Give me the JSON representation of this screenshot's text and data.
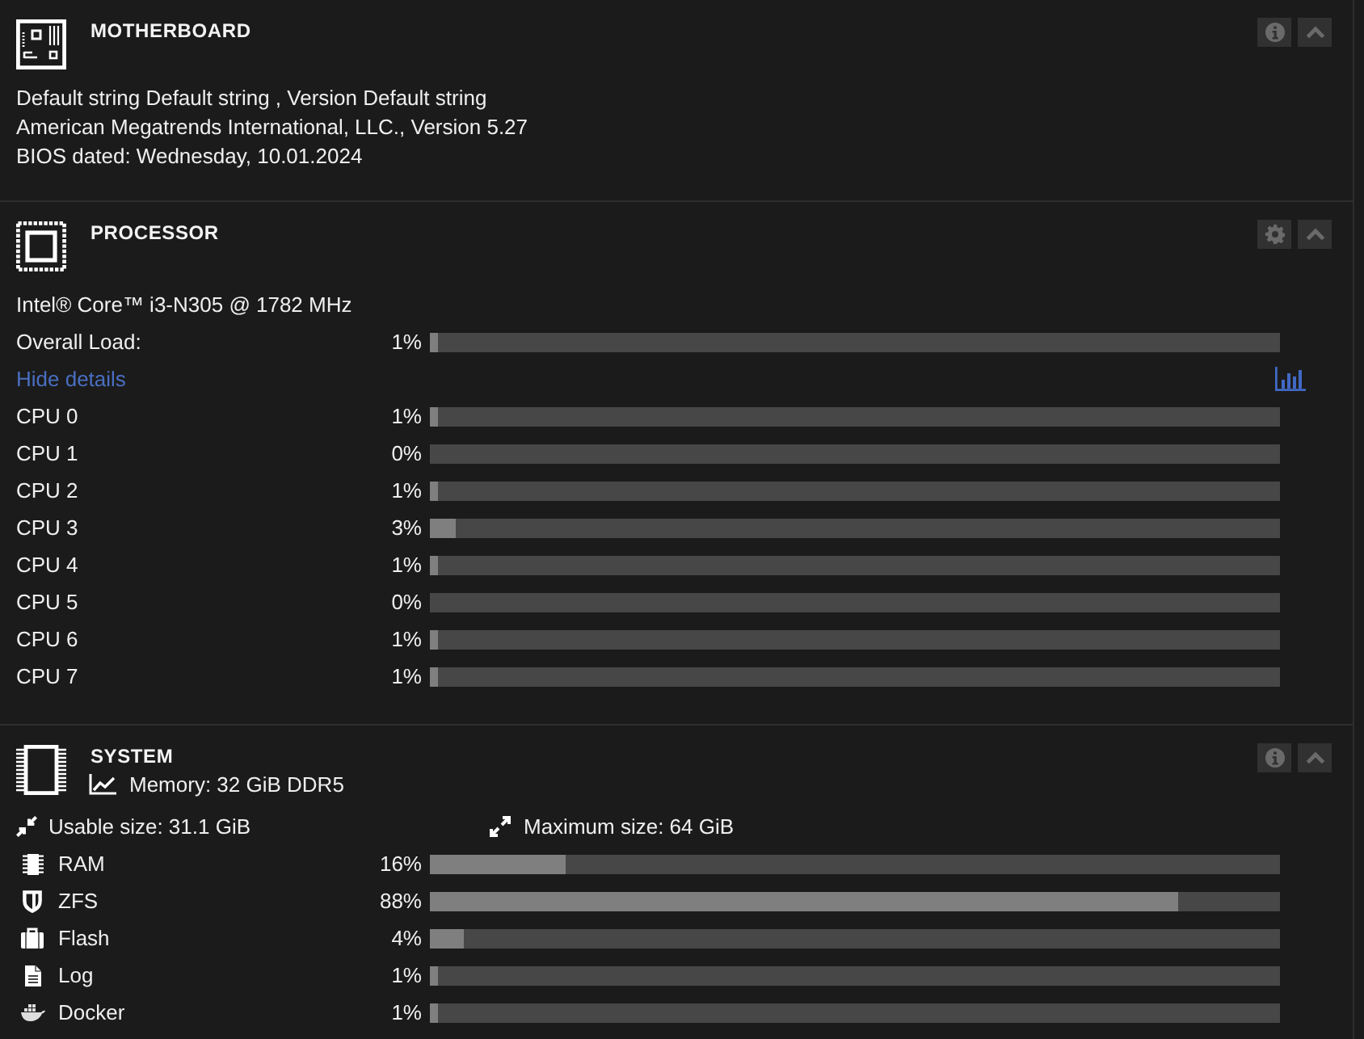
{
  "sections": [
    {
      "kind": "motherboard",
      "title": "MOTHERBOARD",
      "buttons": [
        {
          "kind": "info"
        },
        {
          "kind": "collapse"
        }
      ],
      "lines": [
        "Default string Default string , Version Default string",
        "American Megatrends International, LLC., Version 5.27",
        "BIOS dated: Wednesday, 10.01.2024"
      ]
    },
    {
      "kind": "processor",
      "title": "PROCESSOR",
      "buttons": [
        {
          "kind": "settings"
        },
        {
          "kind": "collapse"
        }
      ],
      "model": "Intel® Core™ i3-N305 @ 1782 MHz",
      "overall": {
        "label": "Overall Load:",
        "reading": "1%",
        "level": 0.01
      },
      "details_link": "Hide details",
      "cores": [
        {
          "name": "CPU 0",
          "reading": "1%",
          "level": 0.01
        },
        {
          "name": "CPU 1",
          "reading": "0%"
        },
        {
          "name": "CPU 2",
          "reading": "1%",
          "level": 0.01
        },
        {
          "name": "CPU 3",
          "reading": "3%",
          "level": 0.03
        },
        {
          "name": "CPU 4",
          "reading": "1%",
          "level": 0.01
        },
        {
          "name": "CPU 5",
          "reading": "0%"
        },
        {
          "name": "CPU 6",
          "reading": "1%",
          "level": 0.01
        },
        {
          "name": "CPU 7",
          "reading": "1%",
          "level": 0.01
        }
      ]
    },
    {
      "kind": "system",
      "title": "SYSTEM",
      "buttons": [
        {
          "kind": "info"
        },
        {
          "kind": "collapse"
        }
      ],
      "memory": "Memory: 32 GiB DDR5",
      "usable_size": "Usable size: 31.1 GiB",
      "maximum_size": "Maximum size: 64 GiB",
      "pools": [
        {
          "kind": "ram",
          "name": "RAM",
          "reading": "16%",
          "level": 0.16
        },
        {
          "kind": "zfs",
          "name": "ZFS",
          "reading": "88%",
          "level": 0.88
        },
        {
          "kind": "flash",
          "name": "Flash",
          "reading": "4%",
          "level": 0.04
        },
        {
          "kind": "log",
          "name": "Log",
          "reading": "1%",
          "level": 0.01
        },
        {
          "kind": "docker",
          "name": "Docker",
          "reading": "1%",
          "level": 0.01
        }
      ]
    }
  ]
}
